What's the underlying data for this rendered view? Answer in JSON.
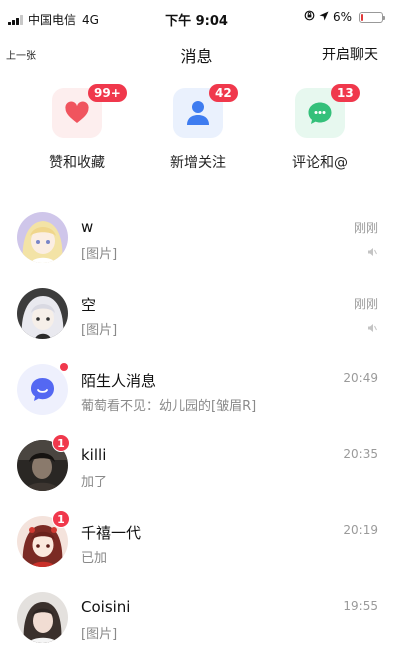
{
  "status_bar": {
    "carrier": "中国电信",
    "network": "4G",
    "time": "下午 9:04",
    "battery": "6%"
  },
  "nav": {
    "back_label": "上一张",
    "title": "消息",
    "action_label": "开启聊天"
  },
  "categories": [
    {
      "label": "赞和收藏",
      "badge": "99+",
      "icon": "heart-icon",
      "bg": "#fdeeee",
      "color": "#f0545e"
    },
    {
      "label": "新增关注",
      "badge": "42",
      "icon": "person-icon",
      "bg": "#eaf1fd",
      "color": "#3e7cf0"
    },
    {
      "label": "评论和@",
      "badge": "13",
      "icon": "comment-icon",
      "bg": "#e7f8ef",
      "color": "#34c07a"
    }
  ],
  "messages": [
    {
      "name": "w",
      "preview": "[图片]",
      "time": "刚刚",
      "muted": true,
      "avatar": "anime-girl-blonde"
    },
    {
      "name": "空",
      "preview": "[图片]",
      "time": "刚刚",
      "muted": true,
      "avatar": "anime-girl-white-hair"
    },
    {
      "name": "陌生人消息",
      "preview": "葡萄看不见：幼儿园的[皱眉R]",
      "time": "20:49",
      "dot": true,
      "avatar": "stranger-message-icon"
    },
    {
      "name": "killi",
      "preview": "加了",
      "time": "20:35",
      "badge": "1",
      "avatar": "dark-photo"
    },
    {
      "name": "千禧一代",
      "preview": "已加",
      "time": "20:19",
      "badge": "1",
      "avatar": "red-anime"
    },
    {
      "name": "Coisini",
      "preview": "[图片]",
      "time": "19:55",
      "avatar": "girl-photo"
    }
  ],
  "colors": {
    "badge": "#f0384c",
    "muted_text": "#8a8a8a"
  }
}
